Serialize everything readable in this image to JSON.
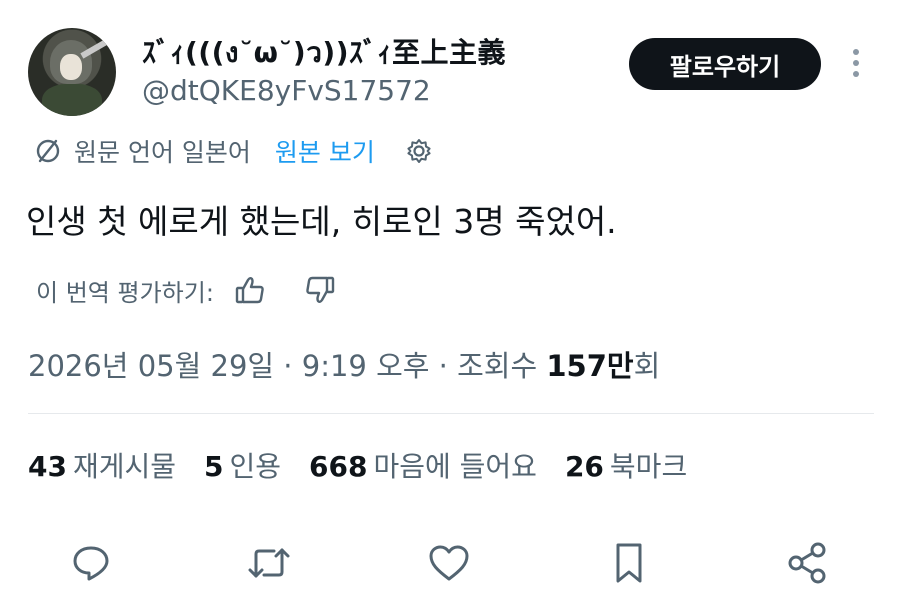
{
  "author": {
    "display_name": "ｽﾞｨ(((ง˘ω˘)ว))ｽﾞｨ至上主義",
    "handle": "@dtQKE8yFvS17572"
  },
  "header": {
    "follow_label": "팔로우하기",
    "more_icon": "more-vertical-icon"
  },
  "translation": {
    "icon": "translate-icon",
    "source_language_label": "원문 언어 일본어",
    "show_original_label": "원본 보기",
    "settings_icon": "gear-icon"
  },
  "tweet": {
    "text": "인생 첫 에로게 했는데, 히로인 3명 죽었어."
  },
  "rate_translation": {
    "label": "이 번역 평가하기:",
    "up_icon": "thumbs-up-icon",
    "down_icon": "thumbs-down-icon"
  },
  "meta": {
    "date_time": "2026년 05월 29일 · 9:19 오후 · 조회수 ",
    "views_value": "157만",
    "views_suffix": "회"
  },
  "stats": [
    {
      "value": "43",
      "label": "재게시물"
    },
    {
      "value": "5",
      "label": "인용"
    },
    {
      "value": "668",
      "label": "마음에 들어요"
    },
    {
      "value": "26",
      "label": "북마크"
    }
  ],
  "actions": [
    "reply-icon",
    "repost-icon",
    "like-icon",
    "bookmark-icon",
    "share-icon"
  ],
  "colors": {
    "accent": "#1d9bf0",
    "text_primary": "#0f1419",
    "text_secondary": "#536471",
    "follow_button_bg": "#0f1419"
  }
}
